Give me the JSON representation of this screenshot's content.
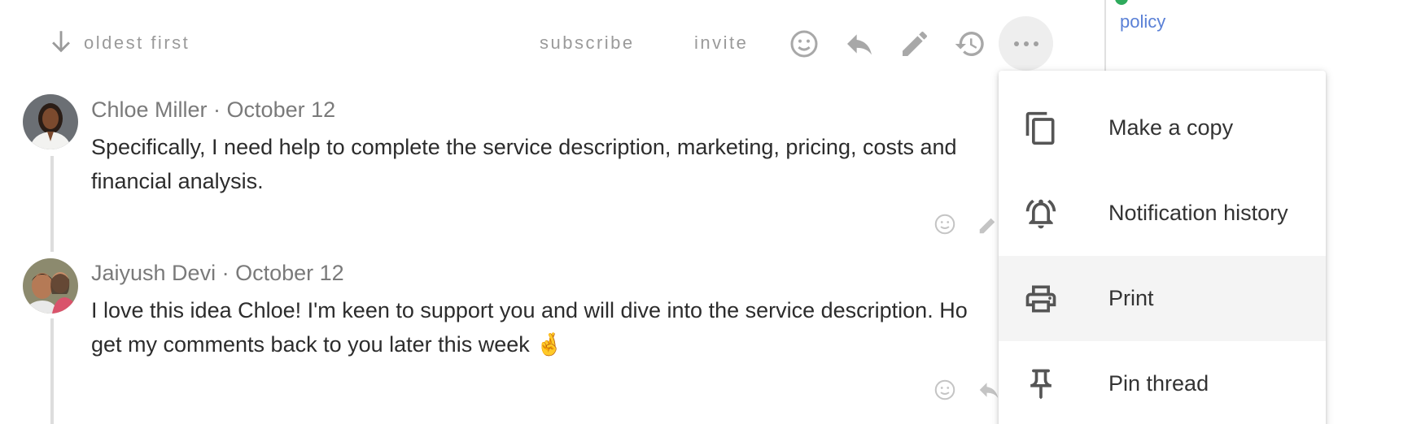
{
  "toolbar": {
    "sort_label": "oldest first",
    "subscribe_label": "subscribe",
    "invite_label": "invite",
    "icons": [
      "arrow-down-icon",
      "smiley-icon",
      "reply-icon",
      "pencil-icon",
      "history-icon",
      "more-icon"
    ]
  },
  "side_panel": {
    "link_tail": "policy"
  },
  "comments": [
    {
      "author": "Chloe Miller",
      "date": "October 12",
      "text": "Specifically, I need help to complete the service description, marketing, pricing, costs and financial analysis."
    },
    {
      "author": "Jaiyush Devi",
      "date": "October 12",
      "text": "I love this idea Chloe! I'm keen to support you and will dive into the service description. Ho get my comments back to you later this week 🤞"
    }
  ],
  "menu": {
    "items": [
      {
        "label": "Make a copy",
        "icon": "copy-icon"
      },
      {
        "label": "Notification history",
        "icon": "bell-ringing-icon"
      },
      {
        "label": "Print",
        "icon": "printer-icon"
      },
      {
        "label": "Pin thread",
        "icon": "pin-icon"
      }
    ]
  },
  "colors": {
    "link": "#5a80d6",
    "muted_text": "#9a9a9a",
    "body_text": "#2c2c2c",
    "menu_hover": "#f4f4f4",
    "thread_line": "#dddddd"
  }
}
